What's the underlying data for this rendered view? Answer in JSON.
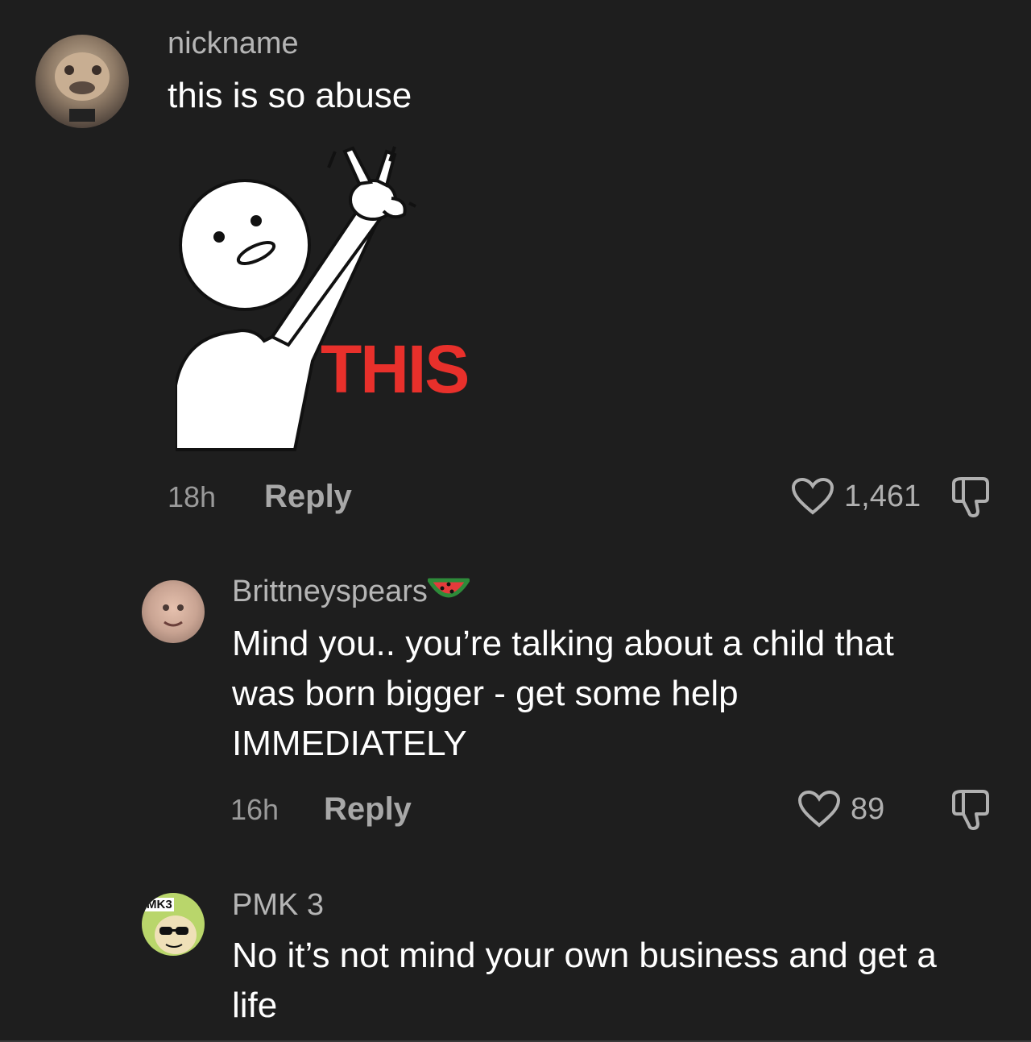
{
  "comments": [
    {
      "username": "nickname",
      "text": "this is so abuse",
      "sticker_text": "THIS",
      "time": "18h",
      "reply_label": "Reply",
      "likes": "1,461"
    },
    {
      "username": "Brittneyspears",
      "text": "Mind you.. you’re talking about a child that was born bigger - get some help IMMEDIATELY",
      "time": "16h",
      "reply_label": "Reply",
      "likes": "89"
    },
    {
      "username": "PMK 3",
      "avatar_text": "MK3",
      "text": "No it’s not mind your own business and get a life"
    }
  ],
  "colors": {
    "background": "#1e1e1e",
    "sticker_text": "#e8302b",
    "username": "#b5b5b5",
    "meta": "#9a9a9a"
  },
  "icons": [
    "heart-icon",
    "thumbs-down-icon",
    "watermelon-emoji"
  ]
}
